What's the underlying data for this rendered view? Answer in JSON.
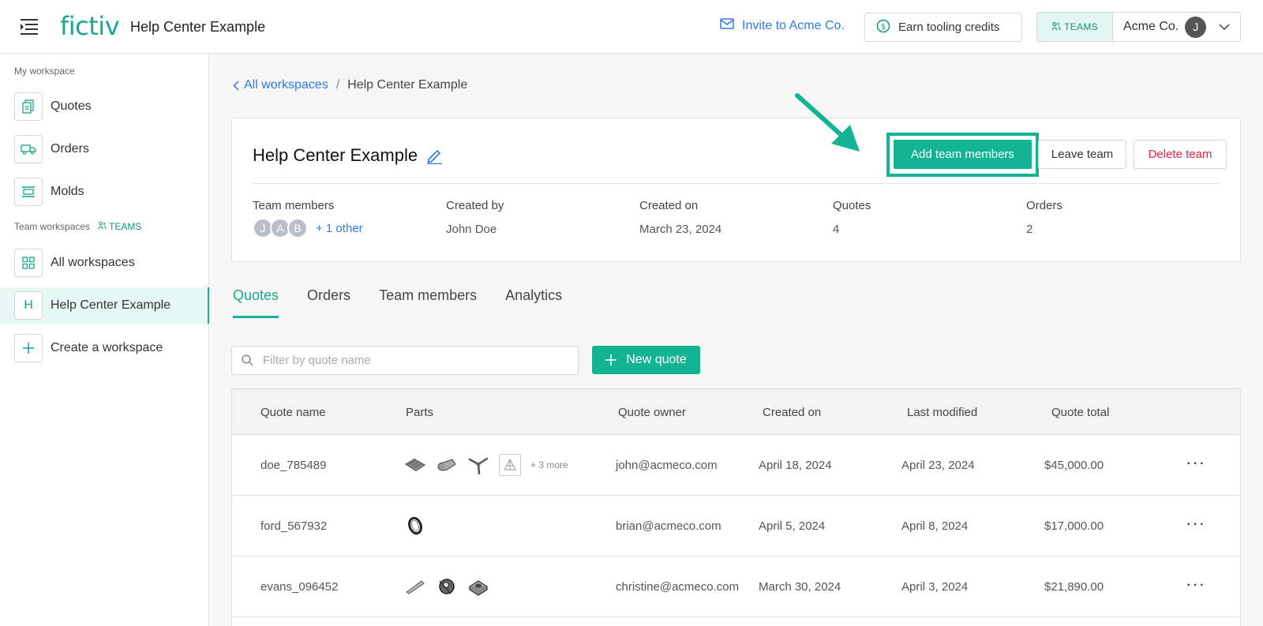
{
  "topbar": {
    "logo": "fictiv",
    "title": "Help Center Example",
    "invite_label": "Invite to Acme Co.",
    "earn_label": "Earn tooling credits",
    "teams_badge": "TEAMS",
    "org_name": "Acme Co.",
    "user_initial": "J"
  },
  "sidebar": {
    "my_workspace_label": "My workspace",
    "team_workspaces_label": "Team workspaces",
    "teams_tag": "TEAMS",
    "items": [
      {
        "label": "Quotes",
        "icon": "quotes-icon"
      },
      {
        "label": "Orders",
        "icon": "truck-icon"
      },
      {
        "label": "Molds",
        "icon": "mold-icon"
      },
      {
        "label": "All workspaces",
        "icon": "grid-icon"
      },
      {
        "label": "Help Center Example",
        "icon_text": "H"
      },
      {
        "label": "Create a workspace",
        "icon": "plus-icon"
      }
    ]
  },
  "breadcrumb": {
    "back": "All workspaces",
    "separator": "/",
    "current": "Help Center Example"
  },
  "team": {
    "name": "Help Center Example",
    "actions": {
      "add": "Add team members",
      "leave": "Leave team",
      "delete": "Delete team"
    },
    "stats": {
      "members_label": "Team members",
      "member_initials": [
        "J",
        "A",
        "B"
      ],
      "members_more": "+ 1 other",
      "created_by_label": "Created by",
      "created_by": "John Doe",
      "created_on_label": "Created on",
      "created_on": "March 23, 2024",
      "quotes_label": "Quotes",
      "quotes": "4",
      "orders_label": "Orders",
      "orders": "2"
    }
  },
  "tabs": [
    "Quotes",
    "Orders",
    "Team members",
    "Analytics"
  ],
  "filter": {
    "placeholder": "Filter by quote name"
  },
  "new_quote_label": "New quote",
  "table": {
    "headers": [
      "Quote name",
      "Parts",
      "Quote owner",
      "Created on",
      "Last modified",
      "Quote total"
    ],
    "rows": [
      {
        "name": "doe_785489",
        "parts_more": "+ 3 more",
        "owner": "john@acmeco.com",
        "created": "April 18, 2024",
        "modified": "April 23, 2024",
        "total": "$45,000.00"
      },
      {
        "name": "ford_567932",
        "parts_more": "",
        "owner": "brian@acmeco.com",
        "created": "April 5, 2024",
        "modified": "April 8, 2024",
        "total": "$17,000.00"
      },
      {
        "name": "evans_096452",
        "parts_more": "",
        "owner": "christine@acmeco.com",
        "created": "March 30, 2024",
        "modified": "April 3, 2024",
        "total": "$21,890.00"
      }
    ],
    "row_menu_glyph": "···"
  },
  "colors": {
    "brand": "#12b493",
    "link": "#2f7be0",
    "danger": "#e0243a"
  }
}
